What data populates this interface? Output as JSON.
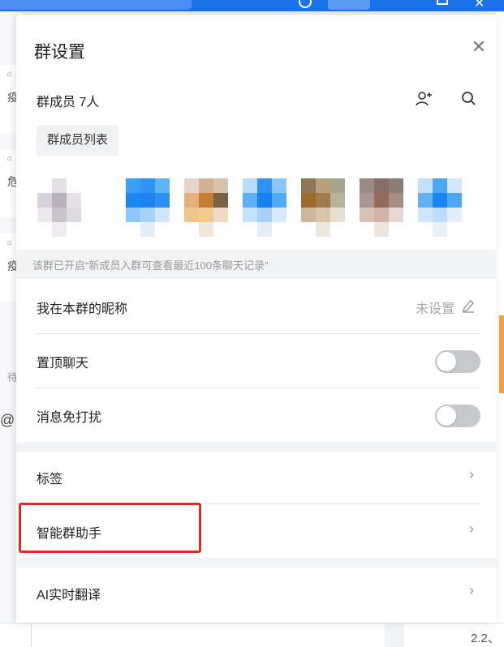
{
  "panel": {
    "title": "群设置",
    "members_label": "群成员 7人",
    "member_list_button": "群成员列表",
    "notice": "该群已开启“新成员入群可查看最近100条聊天记录”"
  },
  "settings": {
    "nickname": {
      "label": "我在本群的昵称",
      "value": "未设置"
    },
    "pin_chat": {
      "label": "置顶聊天",
      "on": false
    },
    "mute": {
      "label": "消息免打扰",
      "on": false
    },
    "tags": {
      "label": "标签"
    },
    "assistant": {
      "label": "智能群助手"
    },
    "translate": {
      "label": "AI实时翻译"
    }
  },
  "background": {
    "left_glyphs": [
      "疫",
      "危",
      "疫"
    ],
    "left_pending": "待",
    "bottom_version": "2.2、"
  },
  "colors": {
    "brand_blue": "#1a73e8",
    "highlight_red": "#e52b1f",
    "toggle_off": "#c8c9cc"
  },
  "icons": {
    "close": "close-icon",
    "add_member": "add-member-icon",
    "search": "search-icon",
    "edit": "pencil-icon",
    "chevron": "chevron-right-icon"
  }
}
